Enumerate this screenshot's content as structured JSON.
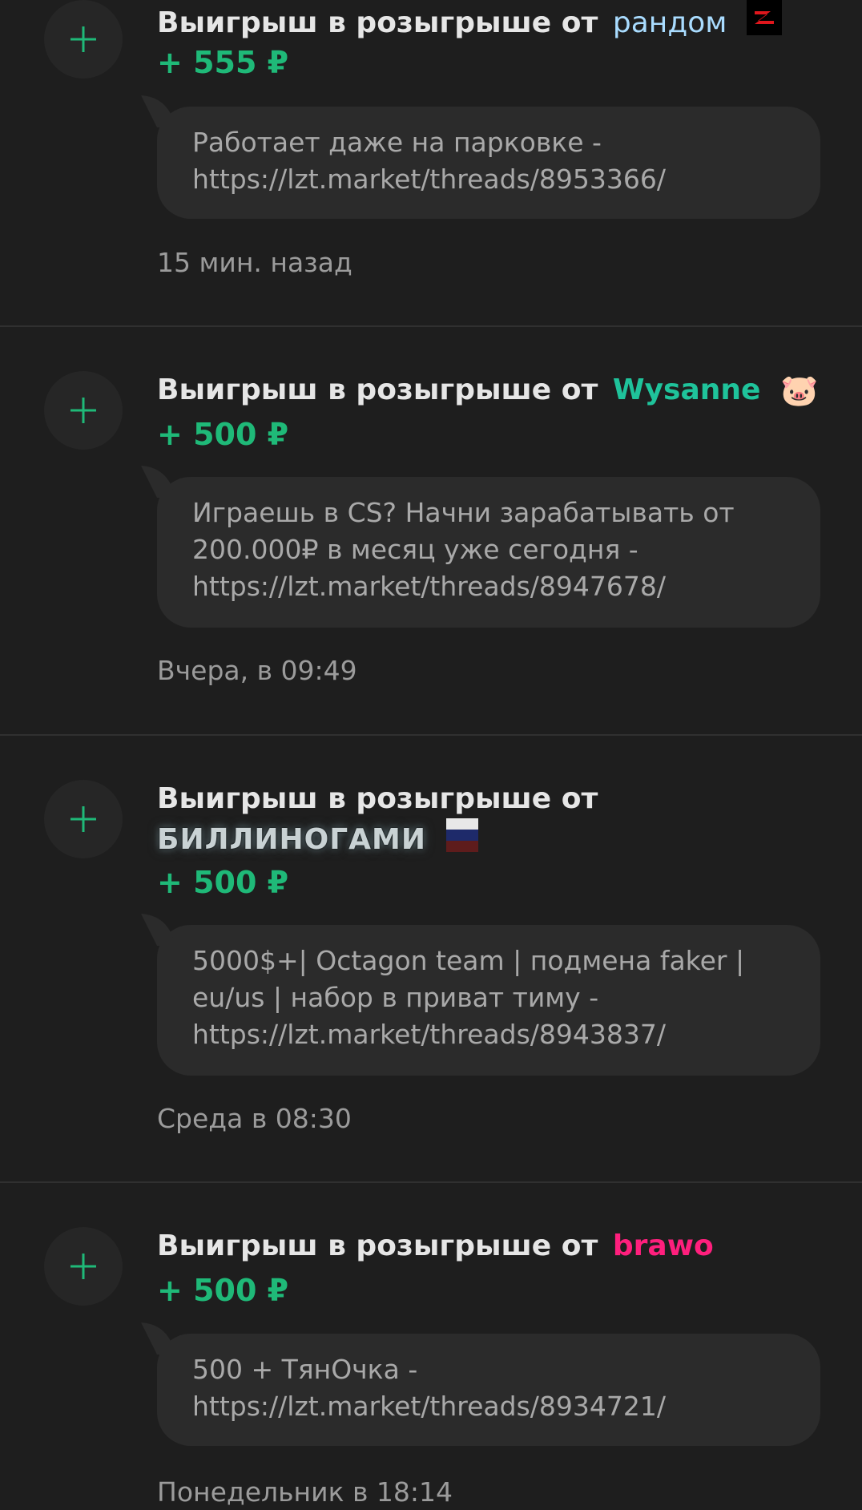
{
  "colors": {
    "background": "#1e1e1e",
    "accent_green": "#1fb978",
    "bubble_bg": "#2b2b2b",
    "divider": "#303030"
  },
  "entries": [
    {
      "icon": "plus-icon",
      "title_prefix": "Выигрыш в розыгрыше от",
      "from_user": "рандом",
      "user_color": "#a9dcff",
      "badge": "red-n-badge",
      "amount": "+ 555 ₽",
      "message": "Работает даже на парковке - https://lzt.market/threads/8953366/",
      "time": "15 мин. назад"
    },
    {
      "icon": "plus-icon",
      "title_prefix": "Выигрыш в розыгрыше от",
      "from_user": "Wysanne",
      "user_color": "#1fc39b",
      "badge": "pig-emoji",
      "badge_text": "🐷",
      "amount": "+ 500 ₽",
      "message": "Играешь в CS? Начни зарабатывать от 200.000₽ в месяц уже сегодня - https://lzt.market/threads/8947678/",
      "time": "Вчера, в 09:49"
    },
    {
      "icon": "plus-icon",
      "title_prefix": "Выигрыш в розыгрыше от",
      "from_user": "БИЛЛИНОГАМИ",
      "user_color": "#c9d2d4",
      "badge": "russia-flag",
      "amount": "+ 500 ₽",
      "message": "5000$+| Octagon team | подмена faker | eu/us | набор в приват тиму - https://lzt.market/threads/8943837/",
      "time": "Среда в 08:30"
    },
    {
      "icon": "plus-icon",
      "title_prefix": "Выигрыш в розыгрыше от",
      "from_user": "brawo",
      "user_color": "#ff1f7d",
      "badge": "",
      "amount": "+ 500 ₽",
      "message": "500 + ТянОчка - https://lzt.market/threads/8934721/",
      "time": "Понедельник в 18:14"
    }
  ]
}
